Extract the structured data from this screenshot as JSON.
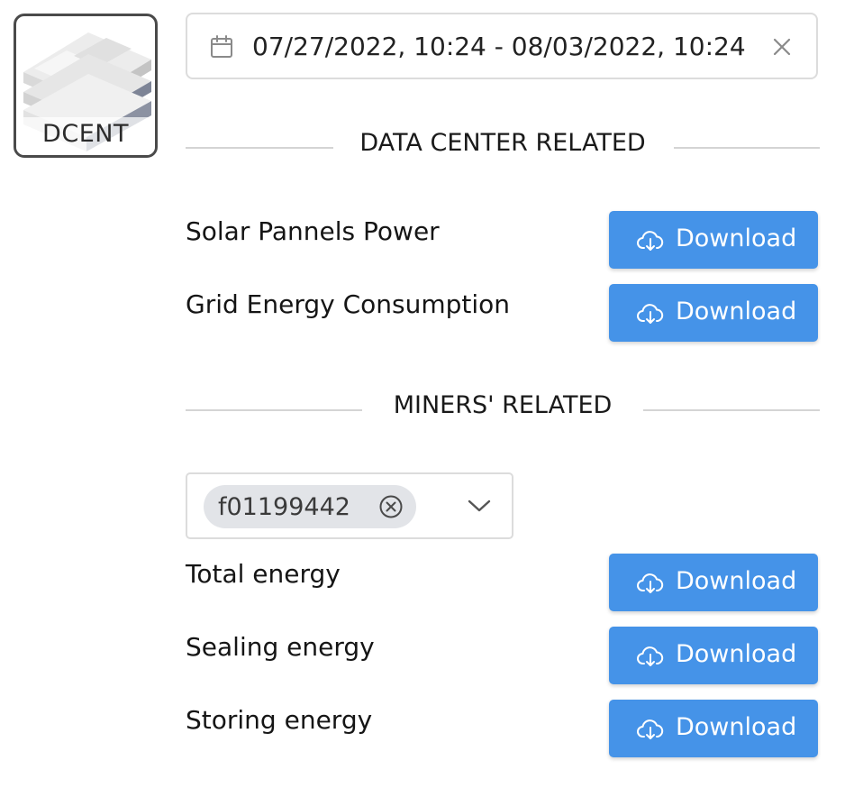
{
  "logo": {
    "label": "DCENT",
    "icon": "server-rack-icon"
  },
  "date_range": {
    "value": "07/27/2022, 10:24 - 08/03/2022, 10:24",
    "calendar_icon": "calendar-icon",
    "clear_icon": "close-icon"
  },
  "sections": {
    "data_center": {
      "title": "DATA CENTER RELATED",
      "rows": [
        {
          "label": "Solar Pannels Power",
          "button": "Download"
        },
        {
          "label": "Grid Energy Consumption",
          "button": "Download"
        }
      ]
    },
    "miners": {
      "title": "MINERS' RELATED",
      "selected_miner": "f01199442",
      "rows": [
        {
          "label": "Total energy",
          "button": "Download"
        },
        {
          "label": "Sealing energy",
          "button": "Download"
        },
        {
          "label": "Storing energy",
          "button": "Download"
        }
      ]
    }
  },
  "colors": {
    "button_bg": "#4593e8",
    "tag_bg": "#e2e4e8",
    "divider": "#d4d4d4",
    "border": "#dcdcdc"
  },
  "icons": {
    "download": "cloud-download-icon",
    "dropdown": "chevron-down-icon",
    "remove_tag": "circle-x-icon"
  }
}
